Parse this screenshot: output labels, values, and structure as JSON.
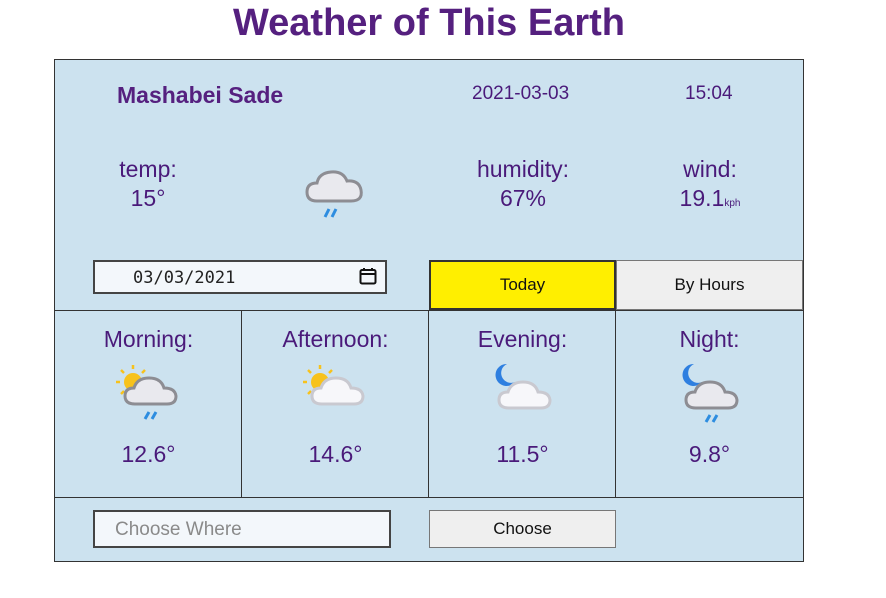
{
  "title": "Weather of This Earth",
  "current": {
    "city": "Mashabei Sade",
    "date": "2021-03-03",
    "time": "15:04",
    "temp_label": "temp:",
    "temp_value": "15°",
    "icon": "cloud-rain-icon",
    "humidity_label": "humidity:",
    "humidity_value": "67%",
    "wind_label": "wind:",
    "wind_value": "19.1",
    "wind_unit": "kph"
  },
  "controls": {
    "date_value": "03/03/2021",
    "today_label": "Today",
    "by_hours_label": "By Hours"
  },
  "periods": [
    {
      "label": "Morning:",
      "temp": "12.6°",
      "icon": "sun-cloud-rain-icon"
    },
    {
      "label": "Afternoon:",
      "temp": "14.6°",
      "icon": "sun-cloud-icon"
    },
    {
      "label": "Evening:",
      "temp": "11.5°",
      "icon": "moon-cloud-icon"
    },
    {
      "label": "Night:",
      "temp": "9.8°",
      "icon": "moon-cloud-rain-icon"
    }
  ],
  "search": {
    "placeholder": "Choose Where",
    "button_label": "Choose"
  },
  "colors": {
    "accent": "#55207f",
    "panel": "#cce2ef",
    "today_button": "#ffef00"
  }
}
